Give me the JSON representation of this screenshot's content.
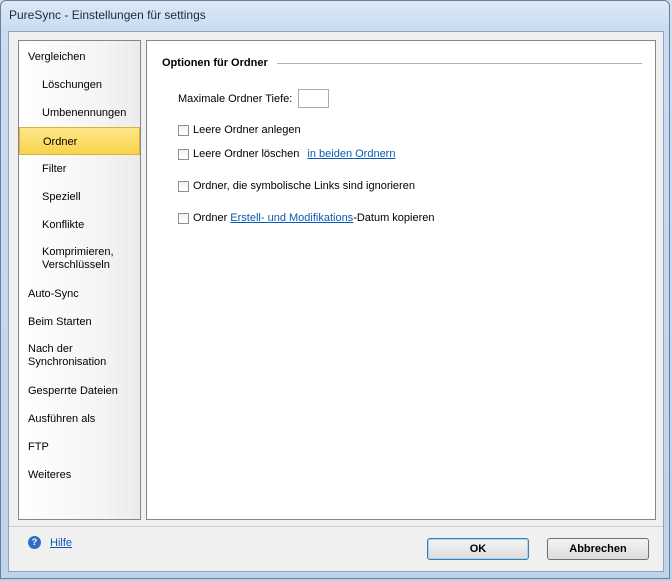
{
  "window": {
    "title": "PureSync - Einstellungen für settings"
  },
  "sidebar": {
    "items": [
      {
        "label": "Vergleichen"
      },
      {
        "label": "Löschungen"
      },
      {
        "label": "Umbenennungen"
      },
      {
        "label": "Ordner"
      },
      {
        "label": "Filter"
      },
      {
        "label": "Speziell"
      },
      {
        "label": "Konflikte"
      },
      {
        "label": "Komprimieren,",
        "label2": "Verschlüsseln"
      },
      {
        "label": "Auto-Sync"
      },
      {
        "label": "Beim Starten"
      },
      {
        "label": "Nach der",
        "label2": "Synchronisation"
      },
      {
        "label": "Gesperrte Dateien"
      },
      {
        "label": "Ausführen als"
      },
      {
        "label": "FTP"
      },
      {
        "label": "Weiteres"
      }
    ]
  },
  "content": {
    "section_title": "Optionen für Ordner",
    "max_depth": {
      "label": "Maximale Ordner Tiefe:",
      "value": ""
    },
    "opt_create_empty": {
      "label": "Leere Ordner anlegen"
    },
    "opt_delete_empty": {
      "label": "Leere Ordner löschen",
      "link": "in beiden Ordnern"
    },
    "opt_ignore_symlinks": {
      "label": "Ordner, die symbolische Links sind ignorieren"
    },
    "opt_copy_dates": {
      "prefix": "Ordner ",
      "link": "Erstell- und Modifikations",
      "suffix": "-Datum kopieren"
    }
  },
  "footer": {
    "help_label": "Hilfe",
    "ok_label": "OK",
    "cancel_label": "Abbrechen"
  }
}
